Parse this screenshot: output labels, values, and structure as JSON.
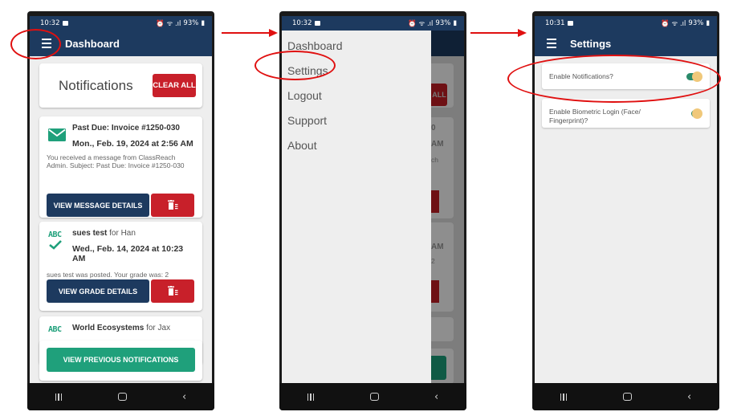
{
  "colors": {
    "navy": "#1d3a5f",
    "red": "#c8202a",
    "green": "#1fa07b",
    "annotation_red": "#e01010"
  },
  "status_bar": {
    "time_phone1": "10:32",
    "time_phone2": "10:32",
    "time_phone3": "10:31",
    "battery": "93%"
  },
  "phone1": {
    "appbar_title": "Dashboard",
    "notifications_title": "Notifications",
    "clear_all_label": "CLEAR ALL",
    "notifications": [
      {
        "icon": "envelope-icon",
        "subject": "Past Due: Invoice #1250-030",
        "for": "",
        "date": "Mon., Feb. 19, 2024 at 2:56 AM",
        "body": "You received a message from ClassReach Admin. Subject: Past Due: Invoice #1250-030",
        "action_label": "VIEW MESSAGE DETAILS"
      },
      {
        "icon": "grade-abc-check-icon",
        "subject": "sues test",
        "for": "for Han",
        "date": "Wed., Feb. 14, 2024 at 10:23 AM",
        "body": "sues test was posted. Your grade was: 2",
        "action_label": "VIEW GRADE DETAILS"
      },
      {
        "icon": "grade-abc-check-icon",
        "subject": "World Ecosystems",
        "for": "for Jax"
      }
    ],
    "view_previous_label": "VIEW PREVIOUS NOTIFICATIONS"
  },
  "phone2": {
    "drawer_items": [
      "Dashboard",
      "Settings",
      "Logout",
      "Support",
      "About"
    ],
    "peek": [
      "ALL",
      "0",
      "AM",
      "ch",
      "AM",
      "2"
    ]
  },
  "phone3": {
    "appbar_title": "Settings",
    "settings": [
      {
        "label": "Enable Notifications?",
        "enabled": true
      },
      {
        "label": "Enable Biometric Login (Face/ Fingerprint)?",
        "enabled": true
      }
    ]
  }
}
